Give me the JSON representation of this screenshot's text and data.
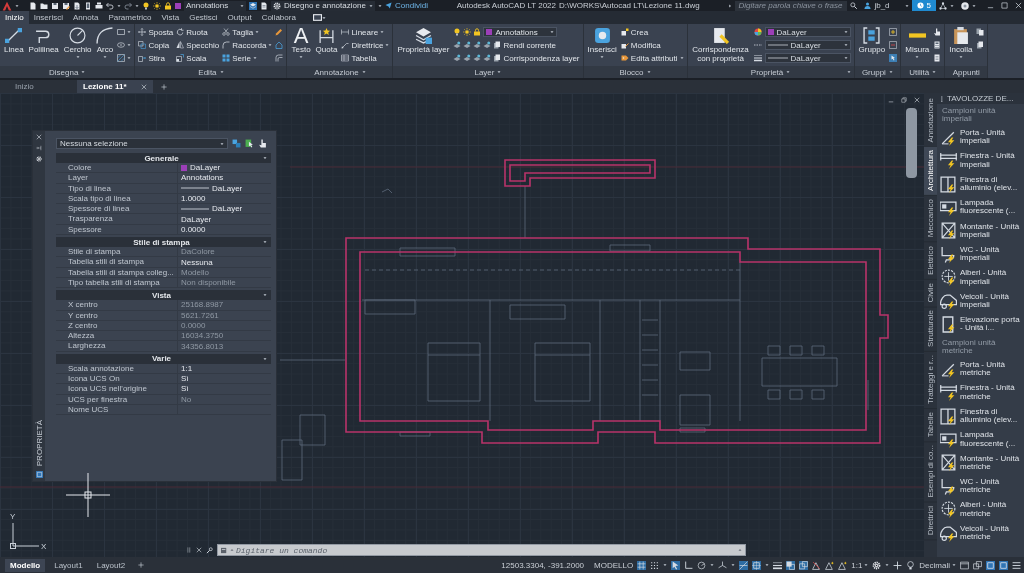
{
  "title_bar": {
    "layer": {
      "value": "Annotations",
      "color": "#9c3fb8"
    },
    "workspace": "Disegno e annotazione",
    "share": "Condividi",
    "app_title": "Autodesk AutoCAD LT 2022",
    "file_path": "D:\\WORKS\\Autocad LT\\Lezione 11.dwg",
    "search": {
      "placeholder": "Digitare parola chiave o frase"
    },
    "user": "jb_d",
    "badge": "5"
  },
  "ribbon_tabs": [
    {
      "label": "Inizio",
      "selected": true
    },
    {
      "label": "Inserisci",
      "selected": false
    },
    {
      "label": "Annota",
      "selected": false
    },
    {
      "label": "Parametrico",
      "selected": false
    },
    {
      "label": "Vista",
      "selected": false
    },
    {
      "label": "Gestisci",
      "selected": false
    },
    {
      "label": "Output",
      "selected": false
    },
    {
      "label": "Collabora",
      "selected": false
    }
  ],
  "ribbon_panels": [
    {
      "title": "Disegna",
      "menu": true,
      "launcher": false,
      "columns": [
        {
          "kind": "large",
          "label": "Linea",
          "menu": false
        },
        {
          "kind": "large",
          "label": "Polilinea",
          "menu": false
        },
        {
          "kind": "large",
          "label": "Cerchio",
          "menu": true
        },
        {
          "kind": "large",
          "label": "Arco",
          "menu": true
        },
        {
          "kind": "stack",
          "rows": [
            {
              "kind": "button",
              "menu": true
            },
            {
              "kind": "button",
              "menu": true
            },
            {
              "kind": "button",
              "menu": true
            }
          ]
        }
      ]
    },
    {
      "title": "Edita",
      "menu": true,
      "launcher": false,
      "columns": [
        {
          "kind": "stack",
          "rows": [
            {
              "kind": "button",
              "label": "Sposta",
              "menu": false
            },
            {
              "kind": "button",
              "label": "Copia",
              "menu": false
            },
            {
              "kind": "button",
              "label": "Stira",
              "menu": false
            }
          ]
        },
        {
          "kind": "stack",
          "rows": [
            {
              "kind": "button",
              "label": "Ruota",
              "menu": false
            },
            {
              "kind": "button",
              "label": "Specchio",
              "menu": false
            },
            {
              "kind": "button",
              "label": "Scala",
              "menu": false
            }
          ]
        },
        {
          "kind": "stack",
          "rows": [
            {
              "kind": "button",
              "label": "Taglia",
              "menu": true
            },
            {
              "kind": "button",
              "label": "Raccorda",
              "menu": true
            },
            {
              "kind": "button",
              "label": "Serie",
              "menu": true
            }
          ]
        },
        {
          "kind": "stack",
          "rows": [
            {
              "kind": "button",
              "menu": false
            },
            {
              "kind": "button",
              "menu": false
            },
            {
              "kind": "button",
              "menu": false
            }
          ]
        }
      ]
    },
    {
      "title": "Annotazione",
      "menu": true,
      "launcher": false,
      "columns": [
        {
          "kind": "large",
          "glyph": "A",
          "label": "Testo",
          "menu": true
        },
        {
          "kind": "large",
          "label": "Quota",
          "menu": false
        },
        {
          "kind": "stack",
          "rows": [
            {
              "kind": "button",
              "label": "Lineare",
              "menu": true
            },
            {
              "kind": "button",
              "label": "Direttrice",
              "menu": true
            },
            {
              "kind": "button",
              "label": "Tabella",
              "menu": false
            }
          ]
        }
      ]
    },
    {
      "title": "Layer",
      "menu": true,
      "launcher": false,
      "columns": [
        {
          "kind": "large",
          "label": "Proprietà layer",
          "menu": false
        },
        {
          "kind": "stack",
          "rows": [
            {
              "kind": "layer_select",
              "value": "Annotations",
              "color": "#9c3fb8"
            },
            {
              "kind": "button",
              "label": "Rendi corrente",
              "menu": false
            },
            {
              "kind": "button",
              "label": "Corrispondenza layer",
              "menu": false
            }
          ]
        }
      ]
    },
    {
      "title": "Blocco",
      "menu": true,
      "launcher": false,
      "columns": [
        {
          "kind": "large",
          "label": "Inserisci",
          "menu": true
        },
        {
          "kind": "stack",
          "rows": [
            {
              "kind": "button",
              "label": "Crea",
              "menu": false
            },
            {
              "kind": "button",
              "label": "Modifica",
              "menu": false
            },
            {
              "kind": "button",
              "label": "Edita attributi",
              "menu": true
            }
          ]
        }
      ]
    },
    {
      "title": "Proprietà",
      "menu": true,
      "launcher": true,
      "columns": [
        {
          "kind": "large",
          "label": "Corrispondenza con proprietà",
          "menu": false
        },
        {
          "kind": "stack",
          "rows": [
            {
              "kind": "button",
              "menu": false
            },
            {
              "kind": "button",
              "menu": false
            },
            {
              "kind": "button",
              "menu": false
            }
          ]
        },
        {
          "kind": "stack",
          "rows": [
            {
              "kind": "color_select",
              "value": "DaLayer",
              "color": "#9c3fb8"
            },
            {
              "kind": "line_select",
              "value": "DaLayer"
            },
            {
              "kind": "line_select",
              "value": "DaLayer"
            }
          ]
        }
      ]
    },
    {
      "title": "Gruppi",
      "menu": true,
      "launcher": false,
      "columns": [
        {
          "kind": "large",
          "label": "Gruppo",
          "menu": false
        },
        {
          "kind": "stack",
          "rows": [
            {
              "kind": "button",
              "menu": false
            },
            {
              "kind": "button",
              "menu": false
            },
            {
              "kind": "button",
              "menu": false
            }
          ]
        }
      ]
    },
    {
      "title": "Utilità",
      "menu": true,
      "launcher": false,
      "columns": [
        {
          "kind": "large",
          "label": "Misura",
          "menu": true
        },
        {
          "kind": "stack",
          "rows": [
            {
              "kind": "button",
              "menu": false
            },
            {
              "kind": "button",
              "menu": false
            },
            {
              "kind": "button",
              "menu": false
            }
          ]
        }
      ]
    },
    {
      "title": "Appunti",
      "menu": false,
      "launcher": false,
      "columns": [
        {
          "kind": "large",
          "label": "Incolla",
          "menu": true
        },
        {
          "kind": "stack",
          "rows": [
            {
              "kind": "button",
              "menu": false
            },
            {
              "kind": "button",
              "menu": false
            }
          ]
        }
      ]
    }
  ],
  "document_tabs": [
    {
      "label": "Inizio",
      "selected": false,
      "closable": false
    },
    {
      "label": "Lezione 11*",
      "selected": true,
      "closable": true
    }
  ],
  "properties_palette": {
    "title": "PROPRIETÀ",
    "selection": "Nessuna selezione",
    "sections": [
      {
        "title": "Generale",
        "expanded": true,
        "rows": [
          {
            "label": "Colore",
            "value": "DaLayer",
            "kind": "color",
            "color": "#9c3fb8",
            "disabled": false
          },
          {
            "label": "Layer",
            "value": "Annotations",
            "kind": "text",
            "disabled": false
          },
          {
            "label": "Tipo di linea",
            "value": "DaLayer",
            "kind": "line",
            "disabled": false
          },
          {
            "label": "Scala tipo di linea",
            "value": "1.0000",
            "kind": "text",
            "disabled": false
          },
          {
            "label": "Spessore di linea",
            "value": "DaLayer",
            "kind": "line",
            "disabled": false
          },
          {
            "label": "Trasparenza",
            "value": "DaLayer",
            "kind": "text",
            "disabled": false
          },
          {
            "label": "Spessore",
            "value": "0.0000",
            "kind": "text",
            "disabled": false
          }
        ]
      },
      {
        "title": "Stile di stampa",
        "expanded": true,
        "rows": [
          {
            "label": "Stile di stampa",
            "value": "DaColore",
            "kind": "text",
            "disabled": true
          },
          {
            "label": "Tabella stili di stampa",
            "value": "Nessuna",
            "kind": "text",
            "disabled": false
          },
          {
            "label": "Tabella stili di stampa colleg...",
            "value": "Modello",
            "kind": "text",
            "disabled": true
          },
          {
            "label": "Tipo tabella stili di stampa",
            "value": "Non disponibile",
            "kind": "text",
            "disabled": true
          }
        ]
      },
      {
        "title": "Vista",
        "expanded": true,
        "rows": [
          {
            "label": "X centro",
            "value": "25168.8987",
            "kind": "text",
            "disabled": true
          },
          {
            "label": "Y centro",
            "value": "5621.7261",
            "kind": "text",
            "disabled": true
          },
          {
            "label": "Z centro",
            "value": "0.0000",
            "kind": "text",
            "disabled": true
          },
          {
            "label": "Altezza",
            "value": "16034.3750",
            "kind": "text",
            "disabled": true
          },
          {
            "label": "Larghezza",
            "value": "34356.8013",
            "kind": "text",
            "disabled": true
          }
        ]
      },
      {
        "title": "Varie",
        "expanded": true,
        "rows": [
          {
            "label": "Scala annotazione",
            "value": "1:1",
            "kind": "text",
            "disabled": false
          },
          {
            "label": "Icona UCS On",
            "value": "Sì",
            "kind": "text",
            "disabled": false
          },
          {
            "label": "Icona UCS nell'origine",
            "value": "Sì",
            "kind": "text",
            "disabled": false
          },
          {
            "label": "UCS per finestra",
            "value": "No",
            "kind": "text",
            "disabled": true
          },
          {
            "label": "Nome UCS",
            "kind": "text",
            "disabled": false
          }
        ]
      }
    ]
  },
  "tool_palette": {
    "title": "TAVOLOZZE DE...",
    "tabs": [
      {
        "label": "Annotazione",
        "selected": false
      },
      {
        "label": "Architettura",
        "selected": true
      },
      {
        "label": "Meccanico",
        "selected": false
      },
      {
        "label": "Elettrico",
        "selected": false
      },
      {
        "label": "Civile",
        "selected": false
      },
      {
        "label": "Strutturale",
        "selected": false
      },
      {
        "label": "Tratteggi e r...",
        "selected": false
      },
      {
        "label": "Tabelle",
        "selected": false
      },
      {
        "label": "Esempi di co...",
        "selected": false
      },
      {
        "label": "Direttrici",
        "selected": false
      }
    ],
    "groups": [
      {
        "title": "Campioni unità imperiali",
        "items": [
          {
            "label": "Porta - Unità imperiali"
          },
          {
            "label": "Finestra - Unità imperiali"
          },
          {
            "label": "Finestra di alluminio (elev..."
          },
          {
            "label": "Lampada fluorescente (..."
          },
          {
            "label": "Montante - Unità imperiali"
          },
          {
            "label": "WC - Unità imperiali"
          },
          {
            "label": "Alberi - Unità imperiali"
          },
          {
            "label": "Veicoli - Unità imperiali"
          },
          {
            "label": "Elevazione porta - Unità i..."
          }
        ]
      },
      {
        "title": "Campioni unità metriche",
        "items": [
          {
            "label": "Porta - Unità metriche"
          },
          {
            "label": "Finestra - Unità metriche"
          },
          {
            "label": "Finestra di alluminio (elev..."
          },
          {
            "label": "Lampada fluorescente (..."
          },
          {
            "label": "Montante - Unità metriche"
          },
          {
            "label": "WC - Unità metriche"
          },
          {
            "label": "Alberi - Unità metriche"
          },
          {
            "label": "Veicoli - Unità metriche"
          }
        ]
      }
    ]
  },
  "ucs_icon": {
    "y_label": "Y",
    "x_label": "X"
  },
  "command_line": {
    "placeholder": "Digitare un comando"
  },
  "status_bar": {
    "layout_tabs": [
      {
        "label": "Modello",
        "selected": true
      },
      {
        "label": "Layout1",
        "selected": false
      },
      {
        "label": "Layout2",
        "selected": false
      }
    ],
    "coordinates": "12503.3304, -391.2000",
    "space": "MODELLO",
    "toggles": [
      {
        "on": true
      },
      {
        "on": false
      },
      {
        "on": true
      },
      {
        "on": false
      },
      {
        "on": false
      },
      {
        "on": false
      },
      {
        "on": true
      },
      {
        "on": true
      },
      {
        "on": false
      },
      {
        "on": true
      },
      {
        "on": true
      }
    ],
    "annotation_scale": "1:1",
    "units": "Decimali"
  }
}
